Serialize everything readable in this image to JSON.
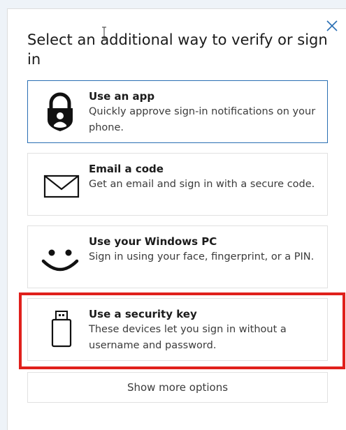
{
  "dialog": {
    "title": "Select an additional way to verify or sign in",
    "close_icon": "close-icon"
  },
  "options": [
    {
      "title": "Use an app",
      "description": "Quickly approve sign-in notifications on your phone.",
      "icon": "lock-person-icon",
      "selected": true
    },
    {
      "title": "Email a code",
      "description": "Get an email and sign in with a secure code.",
      "icon": "envelope-icon",
      "selected": false
    },
    {
      "title": "Use your Windows PC",
      "description": "Sign in using your face, fingerprint, or a PIN.",
      "icon": "smiley-face-icon",
      "selected": false
    },
    {
      "title": "Use a security key",
      "description": "These devices let you sign in without a username and password.",
      "icon": "usb-key-icon",
      "selected": false,
      "highlighted": true
    }
  ],
  "more_options_label": "Show more options",
  "colors": {
    "selected_border": "#2a6fb3",
    "highlight": "#e0201c",
    "close_icon": "#2a6fb3"
  }
}
